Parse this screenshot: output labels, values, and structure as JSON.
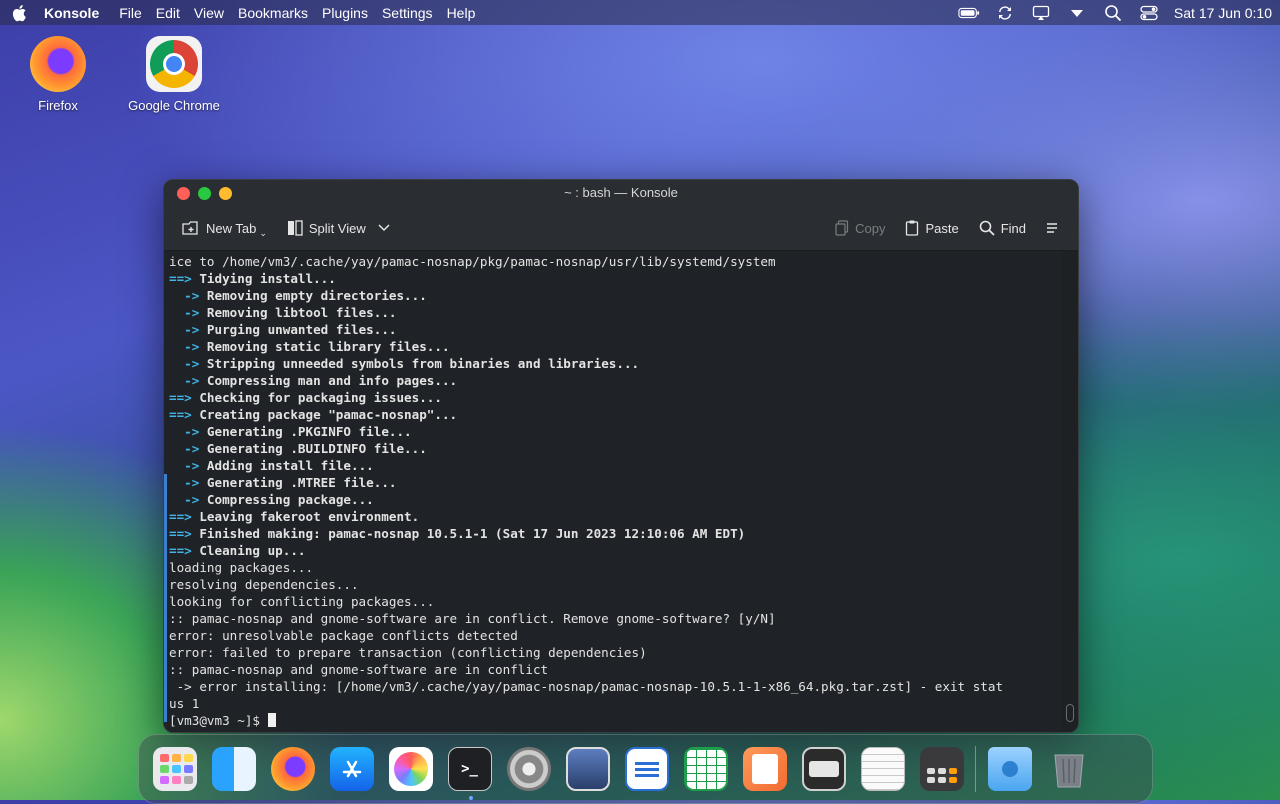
{
  "menubar": {
    "app": "Konsole",
    "items": [
      "File",
      "Edit",
      "View",
      "Bookmarks",
      "Plugins",
      "Settings",
      "Help"
    ],
    "clock": "Sat 17 Jun 0:10"
  },
  "desktop": {
    "icons": [
      {
        "label": "Firefox"
      },
      {
        "label": "Google Chrome"
      }
    ]
  },
  "window": {
    "title": "~ : bash — Konsole",
    "toolbar": {
      "new_tab": "New Tab",
      "split_view": "Split View",
      "copy": "Copy",
      "paste": "Paste",
      "find": "Find"
    }
  },
  "terminal": {
    "lines": [
      "ice to /home/vm3/.cache/yay/pamac-nosnap/pkg/pamac-nosnap/usr/lib/systemd/system",
      "==> Tidying install...",
      "  -> Removing empty directories...",
      "  -> Removing libtool files...",
      "  -> Purging unwanted files...",
      "  -> Removing static library files...",
      "  -> Stripping unneeded symbols from binaries and libraries...",
      "  -> Compressing man and info pages...",
      "==> Checking for packaging issues...",
      "==> Creating package \"pamac-nosnap\"...",
      "  -> Generating .PKGINFO file...",
      "  -> Generating .BUILDINFO file...",
      "  -> Adding install file...",
      "  -> Generating .MTREE file...",
      "  -> Compressing package...",
      "==> Leaving fakeroot environment.",
      "==> Finished making: pamac-nosnap 10.5.1-1 (Sat 17 Jun 2023 12:10:06 AM EDT)",
      "==> Cleaning up...",
      "loading packages...",
      "resolving dependencies...",
      "looking for conflicting packages...",
      ":: pamac-nosnap and gnome-software are in conflict. Remove gnome-software? [y/N]",
      "error: unresolvable package conflicts detected",
      "error: failed to prepare transaction (conflicting dependencies)",
      ":: pamac-nosnap and gnome-software are in conflict",
      " -> error installing: [/home/vm3/.cache/yay/pamac-nosnap/pamac-nosnap-10.5.1-1-x86_64.pkg.tar.zst] - exit stat",
      "us 1"
    ],
    "prompt": "[vm3@vm3 ~]$ "
  },
  "colors": {
    "accent_arrow": "#3fb4e8",
    "close": "#ff5f57",
    "minimize": "#28c840",
    "maximize": "#febc2e"
  },
  "dock": {
    "items": [
      "launchpad-icon",
      "finder-icon",
      "firefox-icon",
      "app-store-icon",
      "photos-icon",
      "terminal-icon",
      "system-settings-icon",
      "screenshot-icon",
      "writer-icon",
      "calc-spreadsheet-icon",
      "draw-icon",
      "media-player-icon",
      "text-editor-icon",
      "calculator-icon",
      "downloads-folder-icon",
      "trash-icon"
    ]
  }
}
